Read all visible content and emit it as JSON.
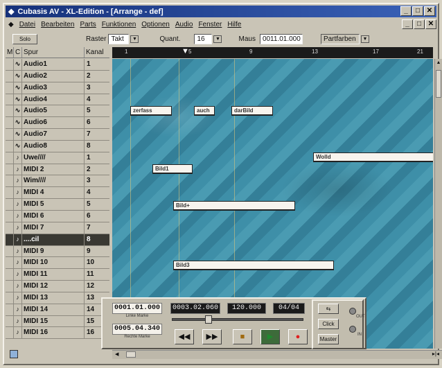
{
  "window": {
    "title": "Cubasis AV - XL-Edition - [Arrange - def]",
    "controls": [
      "_",
      "□",
      "✕"
    ],
    "mdi_controls": [
      "_",
      "□",
      "✕"
    ]
  },
  "menu": [
    "Datei",
    "Bearbeiten",
    "Parts",
    "Funktionen",
    "Optionen",
    "Audio",
    "Fenster",
    "Hilfe"
  ],
  "toolbar": {
    "solo_label": "Solo",
    "raster_label": "Raster",
    "raster_value": "Takt",
    "quant_label": "Quant.",
    "quant_value": "16",
    "maus_label": "Maus",
    "maus_value": "0011.01.000",
    "color_value": "Partfarben"
  },
  "track_header": {
    "m": "M",
    "c": "C",
    "spur": "Spur",
    "kanal": "Kanal"
  },
  "tracks": [
    {
      "c": "∿",
      "name": "Audio1",
      "kanal": "1"
    },
    {
      "c": "∿",
      "name": "Audio2",
      "kanal": "2"
    },
    {
      "c": "∿",
      "name": "Audio3",
      "kanal": "3"
    },
    {
      "c": "∿",
      "name": "Audio4",
      "kanal": "4"
    },
    {
      "c": "∿",
      "name": "Audio5",
      "kanal": "5"
    },
    {
      "c": "∿",
      "name": "Audio6",
      "kanal": "6"
    },
    {
      "c": "∿",
      "name": "Audio7",
      "kanal": "7"
    },
    {
      "c": "∿",
      "name": "Audio8",
      "kanal": "8"
    },
    {
      "c": "♪",
      "name": "Uwe////",
      "kanal": "1"
    },
    {
      "c": "♪",
      "name": "MIDI 2",
      "kanal": "2"
    },
    {
      "c": "♪",
      "name": "Wim////",
      "kanal": "3"
    },
    {
      "c": "♪",
      "name": "MIDI 4",
      "kanal": "4"
    },
    {
      "c": "♪",
      "name": "MIDI 5",
      "kanal": "5"
    },
    {
      "c": "♪",
      "name": "MIDI 6",
      "kanal": "6"
    },
    {
      "c": "♪",
      "name": "MIDI 7",
      "kanal": "7"
    },
    {
      "c": "♪",
      "name": "....cil",
      "kanal": "8"
    },
    {
      "c": "♪",
      "name": "MIDI 9",
      "kanal": "9"
    },
    {
      "c": "♪",
      "name": "MIDI 10",
      "kanal": "10"
    },
    {
      "c": "♪",
      "name": "MIDI 11",
      "kanal": "11"
    },
    {
      "c": "♪",
      "name": "MIDI 12",
      "kanal": "12"
    },
    {
      "c": "♪",
      "name": "MIDI 13",
      "kanal": "13"
    },
    {
      "c": "♪",
      "name": "MIDI 14",
      "kanal": "14"
    },
    {
      "c": "♪",
      "name": "MIDI 15",
      "kanal": "15"
    },
    {
      "c": "♪",
      "name": "MIDI 16",
      "kanal": "16"
    }
  ],
  "ruler": [
    "1",
    "5",
    "9",
    "13",
    "17",
    "21"
  ],
  "parts": [
    {
      "label": "zerfass"
    },
    {
      "label": "auch"
    },
    {
      "label": "darBild"
    },
    {
      "label": "Wolld"
    },
    {
      "label": "Bild1"
    },
    {
      "label": "Bild+"
    },
    {
      "label": "Bild3"
    }
  ],
  "transport": {
    "left_locator": "0001.01.000",
    "left_label": "Linke Marke",
    "position": "0003.02.060",
    "tempo": "120.000",
    "signature": "04/04",
    "right_locator": "0005.04.340",
    "right_label": "Rechte Marke",
    "buttons": [
      "◀◀",
      "▶▶",
      "■",
      "▶",
      "●"
    ],
    "side_buttons": [
      "⇆",
      "Click",
      "Master"
    ],
    "led_labels": [
      "OUT",
      "IN"
    ]
  }
}
